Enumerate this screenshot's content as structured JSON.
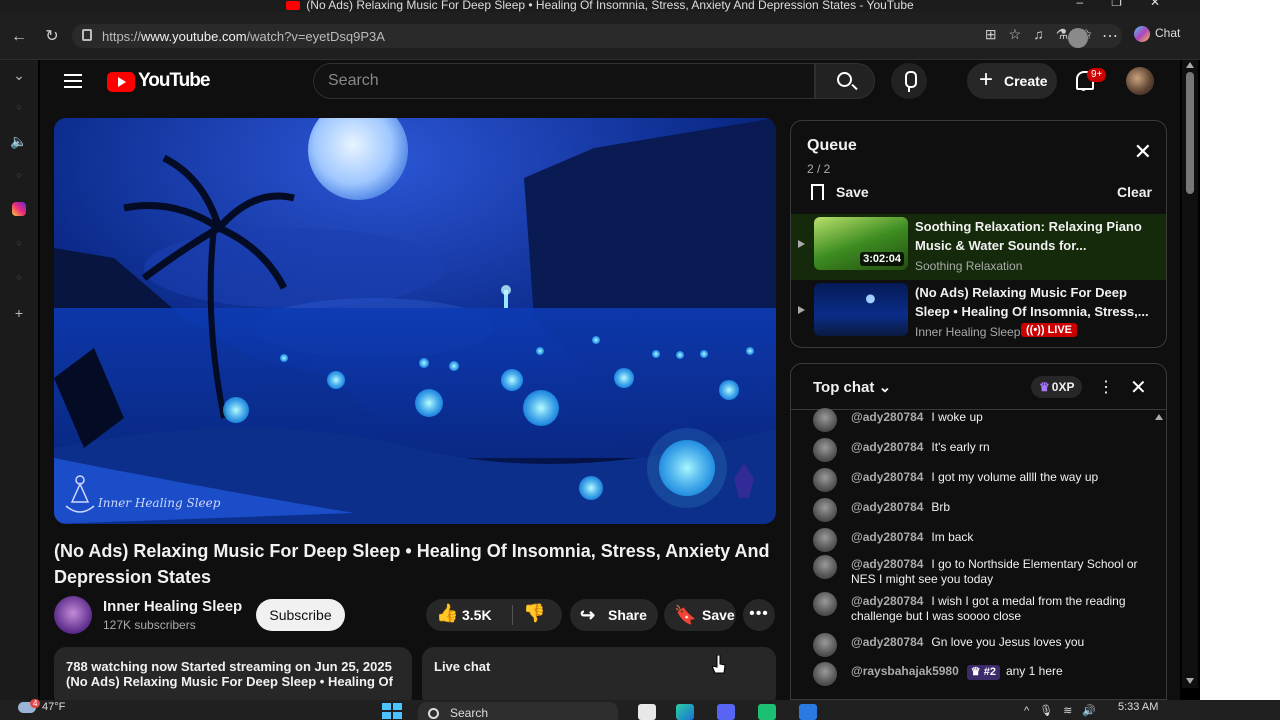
{
  "browser": {
    "tab_title": "(No Ads) Relaxing Music For Deep Sleep • Healing Of Insomnia, Stress, Anxiety And Depression States - YouTube",
    "url_prefix": "https://",
    "url_domain": "www.youtube.com",
    "url_path": "/watch?v=eyetDsq9P3A",
    "copilot_label": "Chat"
  },
  "youtube": {
    "logo_text": "YouTube",
    "search_placeholder": "Search",
    "create_label": "Create",
    "notification_badge": "9+"
  },
  "video": {
    "title": "(No Ads) Relaxing Music For Deep Sleep • Healing Of Insomnia, Stress, Anxiety And Depression States",
    "watermark": "Inner Healing Sleep",
    "channel_name": "Inner Healing Sleep",
    "subscribers": "127K subscribers",
    "subscribe_label": "Subscribe",
    "likes": "3.5K",
    "share_label": "Share",
    "save_label": "Save",
    "description_line1": "788 watching now  Started streaming on Jun 25, 2025",
    "description_line2": "(No Ads) Relaxing Music For Deep Sleep • Healing Of",
    "live_chat_label": "Live chat"
  },
  "queue": {
    "title": "Queue",
    "count": "2 / 2",
    "save_label": "Save",
    "clear_label": "Clear",
    "items": [
      {
        "title": "Soothing Relaxation: Relaxing Piano Music & Water Sounds for...",
        "channel": "Soothing Relaxation",
        "duration": "3:02:04"
      },
      {
        "title": "(No Ads) Relaxing Music For Deep Sleep • Healing Of Insomnia, Stress,...",
        "channel": "Inner Healing Sleep",
        "badge": "LIVE"
      }
    ]
  },
  "chat": {
    "mode": "Top chat",
    "xp": "0XP",
    "messages": [
      {
        "author": "@ady280784",
        "text": "I woke up"
      },
      {
        "author": "@ady280784",
        "text": "It's early rn"
      },
      {
        "author": "@ady280784",
        "text": "I got my volume allll the way up"
      },
      {
        "author": "@ady280784",
        "text": "Brb"
      },
      {
        "author": "@ady280784",
        "text": "Im back"
      },
      {
        "author": "@ady280784",
        "text": "I go to Northside Elementary School or NES I might see you today"
      },
      {
        "author": "@ady280784",
        "text": "I wish I got a medal from the reading challenge but I was soooo close"
      },
      {
        "author": "@ady280784",
        "text": "Gn love you Jesus loves you"
      },
      {
        "author": "@raysbahajak5980",
        "rank": "#2",
        "text": "any 1 here"
      }
    ]
  },
  "taskbar": {
    "temperature": "47°F",
    "search_label": "Search",
    "time": "5:33 AM",
    "weather_badge": "4"
  }
}
